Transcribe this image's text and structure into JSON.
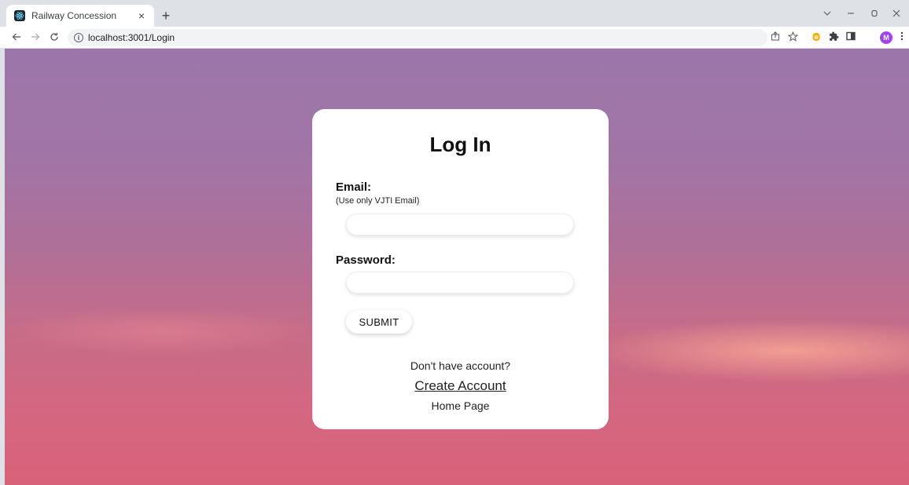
{
  "browser": {
    "tab_title": "Railway Concession",
    "tab_close": "×",
    "new_tab": "+",
    "url": "localhost:3001/Login",
    "avatar_initial": "M",
    "icons": [
      "back-icon",
      "forward-icon",
      "reload-icon",
      "site-info-icon",
      "share-icon",
      "bookmark-star-icon",
      "extension-icon",
      "puzzle-icon",
      "side-panel-icon",
      "menu-icon"
    ]
  },
  "login": {
    "title": "Log In",
    "email_label": "Email:",
    "email_hint": "(Use only VJTI Email)",
    "email_value": "",
    "password_label": "Password:",
    "password_value": "",
    "submit_label": "SUBMIT",
    "no_account_text": "Don't have account?",
    "create_account_link": "Create Account",
    "home_link": "Home Page"
  },
  "colors": {
    "background_top": "#9c76aa",
    "background_bottom": "#d86279",
    "card": "#ffffff"
  }
}
